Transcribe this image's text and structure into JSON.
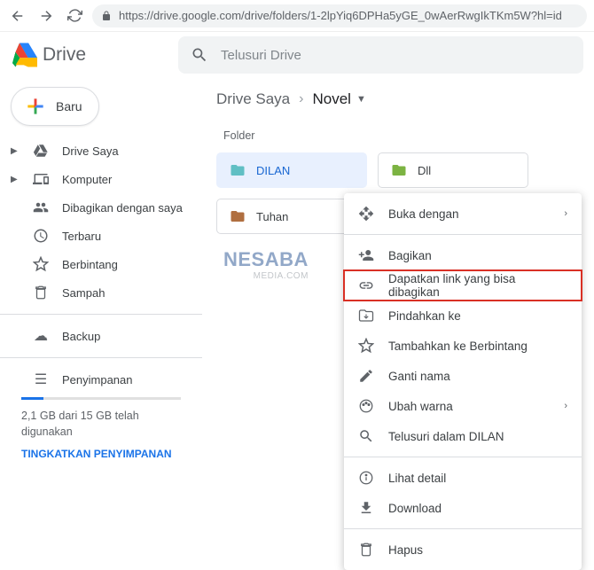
{
  "browser": {
    "url": "https://drive.google.com/drive/folders/1-2lpYiq6DPHa5yGE_0wAerRwgIkTKm5W?hl=id"
  },
  "header": {
    "app_name": "Drive",
    "search_placeholder": "Telusuri Drive"
  },
  "sidebar": {
    "new_label": "Baru",
    "items": [
      {
        "label": "Drive Saya",
        "icon": "drive",
        "expandable": true
      },
      {
        "label": "Komputer",
        "icon": "devices",
        "expandable": true
      },
      {
        "label": "Dibagikan dengan saya",
        "icon": "people",
        "expandable": false
      },
      {
        "label": "Terbaru",
        "icon": "clock",
        "expandable": false
      },
      {
        "label": "Berbintang",
        "icon": "star",
        "expandable": false
      },
      {
        "label": "Sampah",
        "icon": "trash",
        "expandable": false
      }
    ],
    "backup_label": "Backup",
    "storage_label": "Penyimpanan",
    "storage_text": "2,1 GB dari 15 GB telah digunakan",
    "upgrade_text": "TINGKATKAN PENYIMPANAN"
  },
  "main": {
    "breadcrumb": [
      "Drive Saya",
      "Novel"
    ],
    "section_label": "Folder",
    "folders": [
      {
        "name": "DILAN",
        "selected": true,
        "color": "#60bfc4"
      },
      {
        "name": "Dll",
        "selected": false,
        "color": "#7cb342"
      },
      {
        "name": "Tuhan",
        "selected": false,
        "color": "#b06f40"
      }
    ]
  },
  "context_menu": {
    "groups": [
      [
        {
          "label": "Buka dengan",
          "icon": "move-cursor",
          "submenu": true
        }
      ],
      [
        {
          "label": "Bagikan",
          "icon": "person-add"
        },
        {
          "label": "Dapatkan link yang bisa dibagikan",
          "icon": "link",
          "highlighted": true
        },
        {
          "label": "Pindahkan ke",
          "icon": "move-folder"
        },
        {
          "label": "Tambahkan ke Berbintang",
          "icon": "star"
        },
        {
          "label": "Ganti nama",
          "icon": "edit"
        },
        {
          "label": "Ubah warna",
          "icon": "palette",
          "submenu": true
        },
        {
          "label": "Telusuri dalam DILAN",
          "icon": "search"
        }
      ],
      [
        {
          "label": "Lihat detail",
          "icon": "info"
        },
        {
          "label": "Download",
          "icon": "download"
        }
      ],
      [
        {
          "label": "Hapus",
          "icon": "trash"
        }
      ]
    ]
  },
  "watermark": {
    "text": "NESABA",
    "sub": "MEDIA.COM"
  }
}
